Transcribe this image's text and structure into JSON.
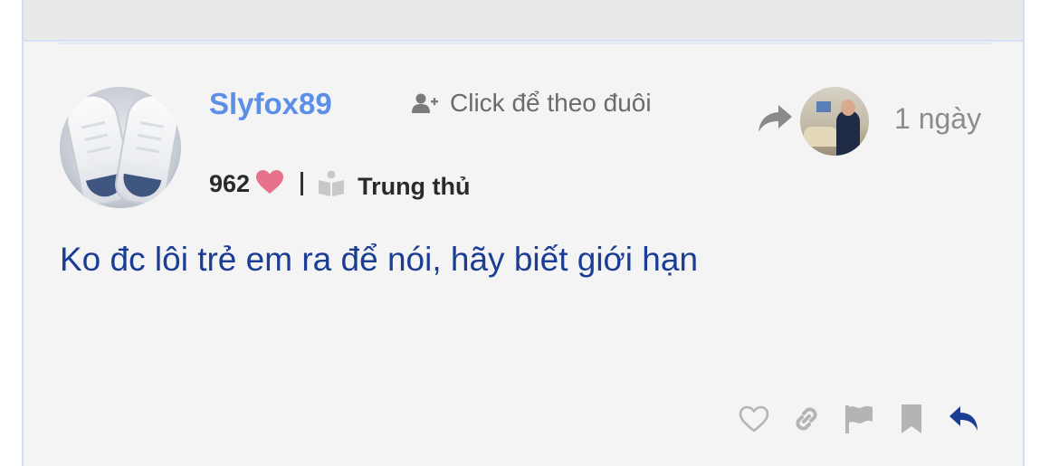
{
  "comment": {
    "author": {
      "username": "Slyfox89",
      "score": "962",
      "rank": "Trung thủ"
    },
    "follow_label": "Click để theo đuôi",
    "time_ago": "1 ngày",
    "message": "Ko đc lôi trẻ em ra để nói, hãy biết giới hạn"
  },
  "icons": {
    "follow": "user-plus-icon",
    "score": "heart-icon",
    "rank": "book-icon",
    "share": "share-icon",
    "like": "heart-outline-icon",
    "link": "link-icon",
    "report": "flag-icon",
    "bookmark": "bookmark-icon",
    "reply": "reply-icon"
  },
  "colors": {
    "username": "#5b8fe8",
    "message": "#1b3e94",
    "heart": "#e8718d",
    "reply": "#1b3e94",
    "muted_icons": "#b4b4b4"
  }
}
